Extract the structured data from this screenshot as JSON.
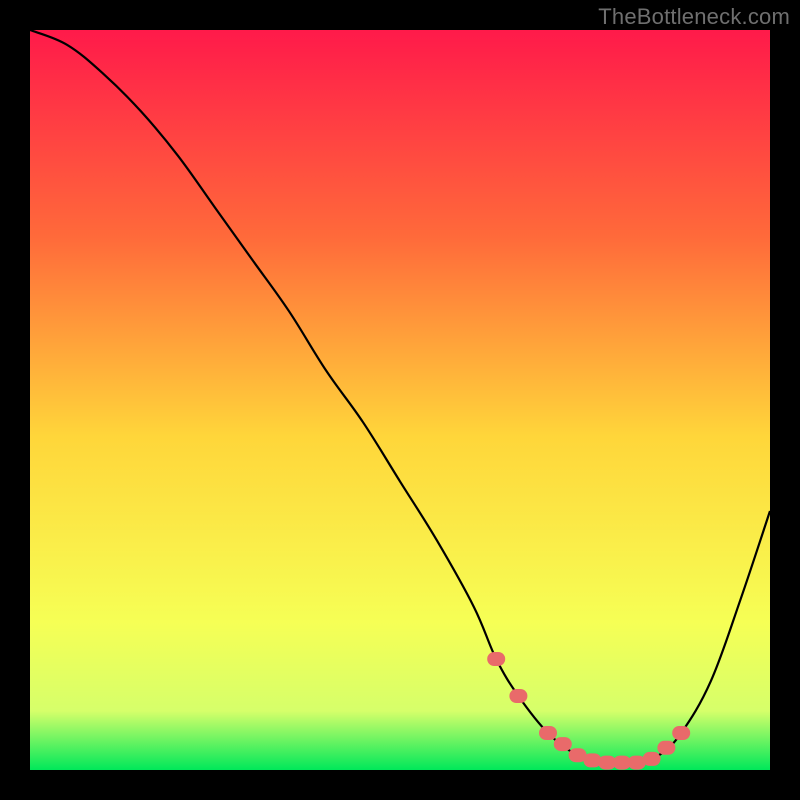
{
  "watermark": "TheBottleneck.com",
  "colors": {
    "background": "#000000",
    "gradient_top": "#ff1a4a",
    "gradient_upper_mid": "#ff6a3a",
    "gradient_mid": "#ffd63a",
    "gradient_lower": "#f6ff55",
    "gradient_band": "#d6ff6a",
    "gradient_bottom": "#00e85a",
    "curve": "#000000",
    "marker": "#e96a6a"
  },
  "chart_data": {
    "type": "line",
    "title": "",
    "xlabel": "",
    "ylabel": "",
    "xlim": [
      0,
      100
    ],
    "ylim": [
      0,
      100
    ],
    "grid": false,
    "legend": false,
    "series": [
      {
        "name": "bottleneck-curve",
        "x": [
          0,
          5,
          10,
          15,
          20,
          25,
          30,
          35,
          40,
          45,
          50,
          55,
          60,
          63,
          66,
          70,
          74,
          78,
          82,
          85,
          88,
          92,
          96,
          100
        ],
        "values": [
          100,
          98,
          94,
          89,
          83,
          76,
          69,
          62,
          54,
          47,
          39,
          31,
          22,
          15,
          10,
          5,
          2,
          1,
          1,
          2,
          5,
          12,
          23,
          35
        ]
      }
    ],
    "markers": {
      "name": "highlight-range",
      "x": [
        63,
        66,
        70,
        72,
        74,
        76,
        78,
        80,
        82,
        84,
        86,
        88
      ],
      "values": [
        15,
        10,
        5,
        3.5,
        2,
        1.3,
        1,
        1,
        1,
        1.5,
        3,
        5
      ]
    }
  }
}
